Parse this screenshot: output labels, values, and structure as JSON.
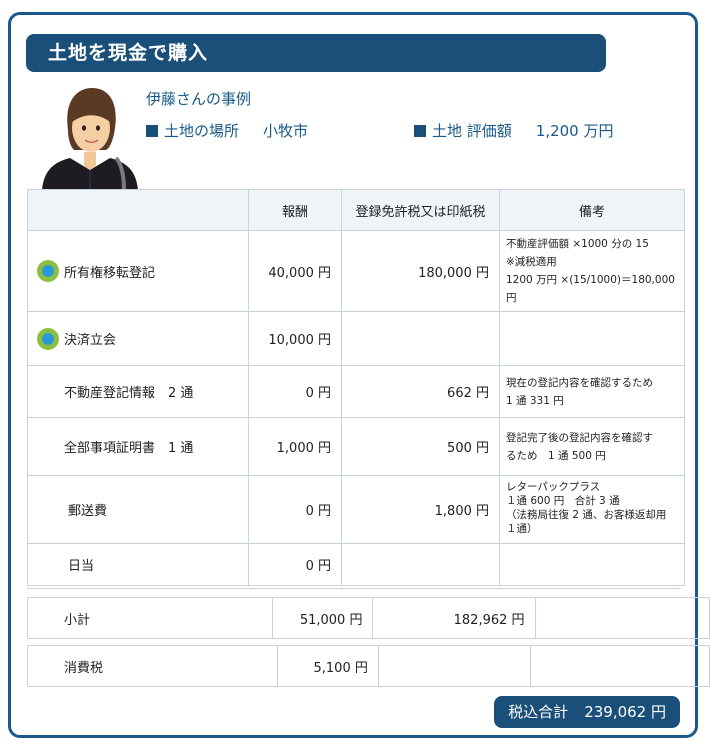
{
  "header": {
    "title": "土地を現金で購入"
  },
  "case": {
    "title": "伊藤さんの事例",
    "location_label": "土地の場所",
    "location_value": "小牧市",
    "valuation_label": "土地 評価額",
    "valuation_value": "1,200 万円"
  },
  "table": {
    "headers": [
      "",
      "報酬",
      "登録免許税又は印紙税",
      "備考"
    ],
    "rows": [
      {
        "item": "所有権移転登記",
        "fee": "40,000 円",
        "tax": "180,000 円",
        "notes": [
          "不動産評価額 ×1000 分の 15",
          "※減税適用",
          "1200 万円 ×(15/1000)＝180,000 円"
        ],
        "bullet": true
      },
      {
        "item": "決済立会",
        "fee": "10,000 円",
        "tax": "",
        "notes": [],
        "bullet": true
      },
      {
        "item": "不動産登記情報　2 通",
        "fee": "0 円",
        "tax": "662 円",
        "notes": [
          "現在の登記内容を確認するため",
          "1 通 331 円"
        ],
        "bullet": false
      },
      {
        "item": "全部事項証明書　1 通",
        "fee": "1,000 円",
        "tax": "500 円",
        "notes": [
          "登記完了後の登記内容を確認す",
          "るため　1 通 500 円"
        ],
        "bullet": false
      },
      {
        "item": "郵送費",
        "fee": "0 円",
        "tax": "1,800 円",
        "notes": [
          "レターパックプラス",
          "１通 600 円　合計 3 通",
          "（法務局往復 2 通、お客様返却用",
          "１通）"
        ],
        "bullet": false
      },
      {
        "item": "日当",
        "fee": "0 円",
        "tax": "",
        "notes": [],
        "bullet": false
      }
    ]
  },
  "summary": {
    "label": "小計",
    "fee": "51,000 円",
    "tax": "182,962 円"
  },
  "consumption_tax": {
    "label": "消費税",
    "fee": "5,100 円"
  },
  "total": {
    "label": "税込合計",
    "value": "239,062 円"
  }
}
